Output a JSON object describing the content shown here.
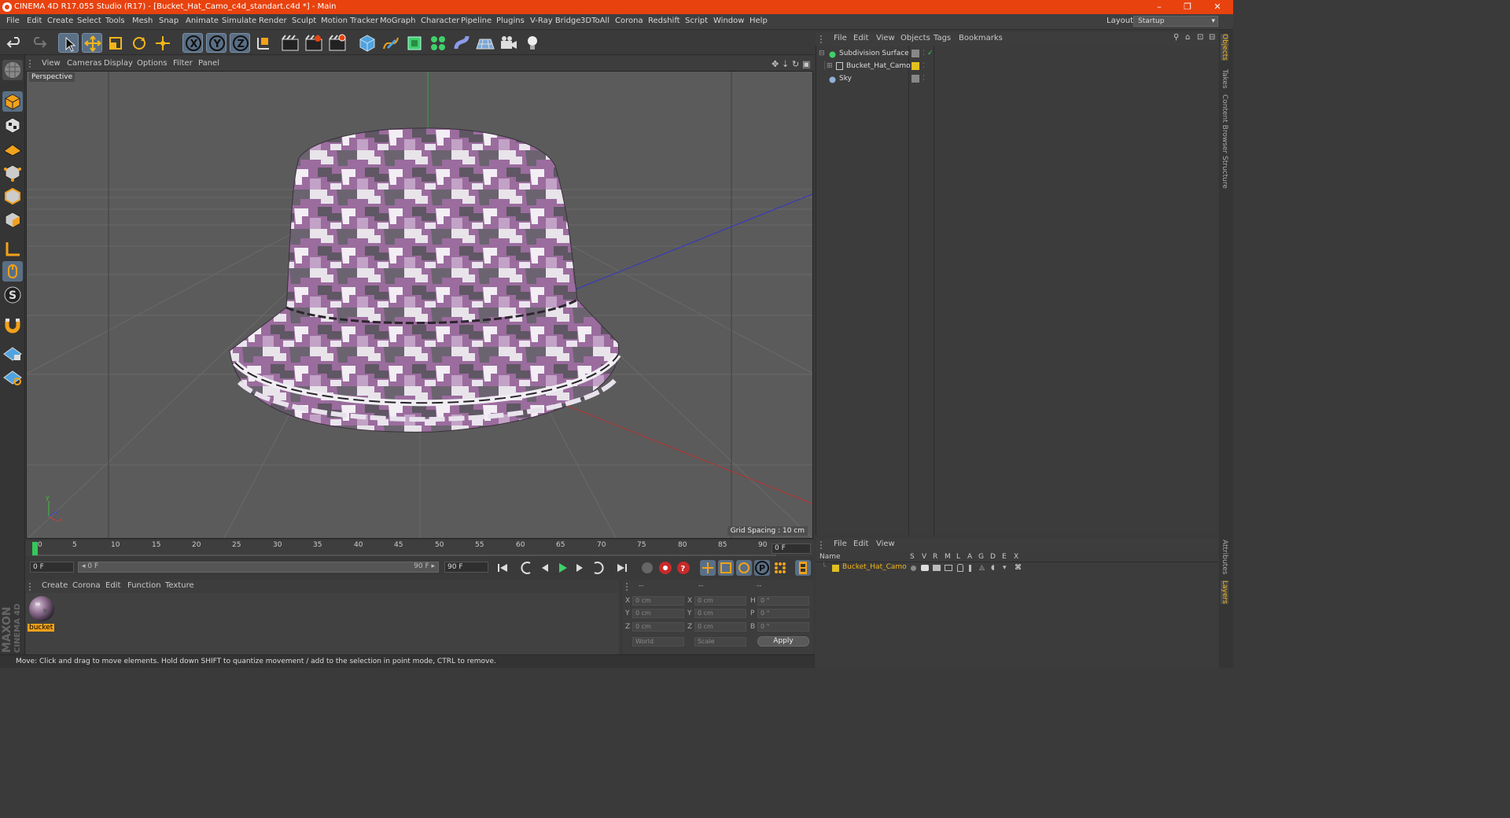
{
  "window": {
    "title": "CINEMA 4D R17.055 Studio (R17) - [Bucket_Hat_Camo_c4d_standart.c4d *] - Main",
    "controls": [
      "–",
      "❐",
      "✕"
    ]
  },
  "menubar": {
    "items": [
      "File",
      "Edit",
      "Create",
      "Select",
      "Tools",
      "Mesh",
      "Snap",
      "Animate",
      "Simulate",
      "Render",
      "Sculpt",
      "Motion Tracker",
      "MoGraph",
      "Character",
      "Pipeline",
      "Plugins",
      "V-Ray Bridge",
      "3DToAll",
      "Corona",
      "Redshift",
      "Script",
      "Window",
      "Help"
    ],
    "layout_label": "Layout:",
    "layout_value": "Startup"
  },
  "viewport": {
    "menu": [
      "View",
      "Cameras",
      "Display",
      "Options",
      "Filter",
      "Panel"
    ],
    "label": "Perspective",
    "grid_spacing": "Grid Spacing : 10 cm",
    "icons": [
      "move-view-icon",
      "zoom-view-icon",
      "rotate-view-icon",
      "maximize-view-icon"
    ]
  },
  "timeline": {
    "ticks": [
      "0",
      "5",
      "10",
      "15",
      "20",
      "25",
      "30",
      "35",
      "40",
      "45",
      "50",
      "55",
      "60",
      "65",
      "70",
      "75",
      "80",
      "85",
      "90"
    ],
    "current_frame": "0 F"
  },
  "playback": {
    "start_field": "0 F",
    "range_start": "◂ 0 F",
    "range_end": "90 F ▸",
    "end_field": "90 F"
  },
  "material_manager": {
    "menu": [
      "Create",
      "Corona",
      "Edit",
      "Function",
      "Texture"
    ],
    "materials": [
      {
        "name": "bucket"
      }
    ]
  },
  "coordinates": {
    "headers": [
      "--",
      "--",
      "--"
    ],
    "rows": [
      {
        "a_label": "X",
        "a_value": "0 cm",
        "b_label": "X",
        "b_value": "0 cm",
        "c_label": "H",
        "c_value": "0 °"
      },
      {
        "a_label": "Y",
        "a_value": "0 cm",
        "b_label": "Y",
        "b_value": "0 cm",
        "c_label": "P",
        "c_value": "0 °"
      },
      {
        "a_label": "Z",
        "a_value": "0 cm",
        "b_label": "Z",
        "b_value": "0 cm",
        "c_label": "B",
        "c_value": "0 °"
      }
    ],
    "mode": "World",
    "scale": "Scale",
    "apply": "Apply"
  },
  "status": "Move: Click and drag to move elements. Hold down SHIFT to quantize movement / add to the selection in point mode, CTRL to remove.",
  "object_manager": {
    "menu": [
      "File",
      "Edit",
      "View",
      "Objects",
      "Tags",
      "Bookmarks"
    ],
    "objects": [
      {
        "name": "Subdivision Surface",
        "color": "#3fd06a"
      },
      {
        "name": "Bucket_Hat_Camo",
        "color": "#cccccc"
      },
      {
        "name": "Sky",
        "color": "#8fb2d8"
      }
    ]
  },
  "layer_manager": {
    "menu": [
      "File",
      "Edit",
      "View"
    ],
    "headers": [
      "Name",
      "S",
      "V",
      "R",
      "M",
      "L",
      "A",
      "G",
      "D",
      "E",
      "X"
    ],
    "layers": [
      {
        "name": "Bucket_Hat_Camo",
        "color": "#e0c020"
      }
    ]
  },
  "side_tabs": [
    "Objects",
    "Takes",
    "Content Browser",
    "Structure",
    "Attributes",
    "Layers"
  ],
  "brand": {
    "line1": "MAXON",
    "line2": "CINEMA 4D"
  },
  "colors": {
    "accent": "#e8420f",
    "selection": "#f2a11a",
    "viewport_bg": "#5b5b5b"
  }
}
